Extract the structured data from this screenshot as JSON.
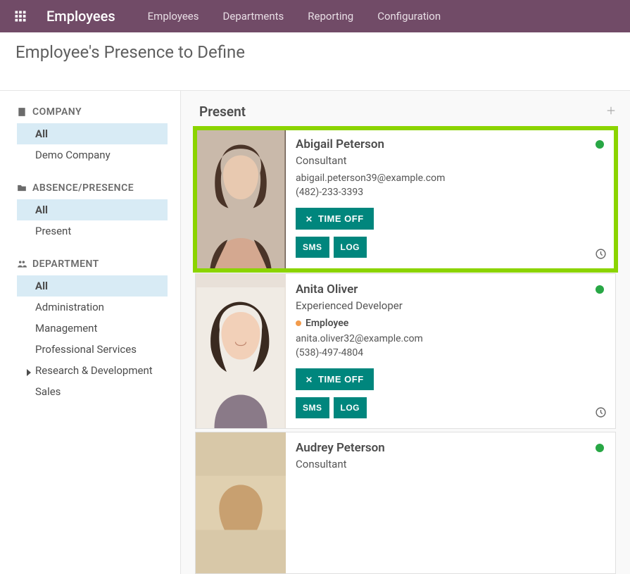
{
  "header": {
    "app_title": "Employees",
    "nav": [
      "Employees",
      "Departments",
      "Reporting",
      "Configuration"
    ]
  },
  "breadcrumb": {
    "title": "Employee's Presence to Define"
  },
  "sidebar": {
    "sections": [
      {
        "label": "COMPANY",
        "items": [
          {
            "label": "All",
            "active": true
          },
          {
            "label": "Demo Company"
          }
        ]
      },
      {
        "label": "ABSENCE/PRESENCE",
        "items": [
          {
            "label": "All",
            "active": true
          },
          {
            "label": "Present"
          }
        ]
      },
      {
        "label": "DEPARTMENT",
        "items": [
          {
            "label": "All",
            "active": true
          },
          {
            "label": "Administration"
          },
          {
            "label": "Management"
          },
          {
            "label": "Professional Services"
          },
          {
            "label": "Research & Development",
            "expandable": true
          },
          {
            "label": "Sales"
          }
        ]
      }
    ]
  },
  "content": {
    "column_title": "Present",
    "timeoff_label": "TIME OFF",
    "sms_label": "SMS",
    "log_label": "LOG",
    "employees": [
      {
        "name": "Abigail Peterson",
        "title": "Consultant",
        "email": "abigail.peterson39@example.com",
        "phone": "(482)-233-3393",
        "status": "present",
        "highlight": true
      },
      {
        "name": "Anita Oliver",
        "title": "Experienced Developer",
        "tag": "Employee",
        "email": "anita.oliver32@example.com",
        "phone": "(538)-497-4804",
        "status": "present"
      },
      {
        "name": "Audrey Peterson",
        "title": "Consultant",
        "status": "present",
        "partial": true
      }
    ]
  },
  "colors": {
    "brand": "#714b67",
    "accent": "#00867d",
    "highlight": "#8bd400",
    "present": "#28a745",
    "sidebar_active": "#d8ebf5"
  }
}
